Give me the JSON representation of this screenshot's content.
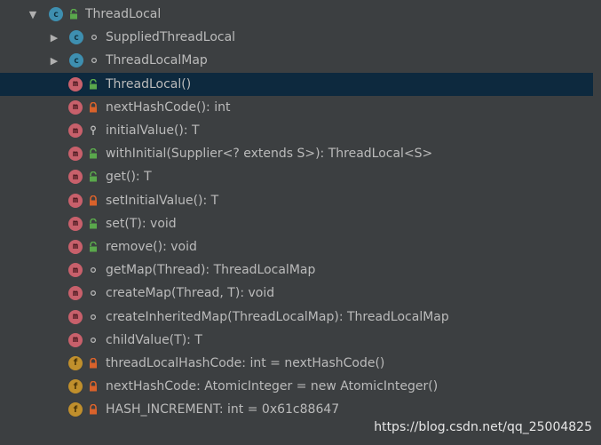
{
  "tree": {
    "root": {
      "label": "ThreadLocal",
      "icon": "class-icon",
      "visibility": "public",
      "expanded": true
    },
    "children": [
      {
        "label": "SuppliedThreadLocal",
        "icon": "class-icon",
        "visibility": "package",
        "collapsed": true
      },
      {
        "label": "ThreadLocalMap",
        "icon": "class-icon",
        "visibility": "package",
        "collapsed": true
      },
      {
        "label": "ThreadLocal()",
        "icon": "method-icon",
        "visibility": "public",
        "selected": true
      },
      {
        "label": "nextHashCode(): int",
        "icon": "method-icon",
        "visibility": "private"
      },
      {
        "label": "initialValue(): T",
        "icon": "method-icon",
        "visibility": "protected"
      },
      {
        "label": "withInitial(Supplier<? extends S>): ThreadLocal<S>",
        "icon": "method-icon",
        "visibility": "public"
      },
      {
        "label": "get(): T",
        "icon": "method-icon",
        "visibility": "public"
      },
      {
        "label": "setInitialValue(): T",
        "icon": "method-icon",
        "visibility": "private"
      },
      {
        "label": "set(T): void",
        "icon": "method-icon",
        "visibility": "public"
      },
      {
        "label": "remove(): void",
        "icon": "method-icon",
        "visibility": "public"
      },
      {
        "label": "getMap(Thread): ThreadLocalMap",
        "icon": "method-icon",
        "visibility": "package"
      },
      {
        "label": "createMap(Thread, T): void",
        "icon": "method-icon",
        "visibility": "package"
      },
      {
        "label": "createInheritedMap(ThreadLocalMap): ThreadLocalMap",
        "icon": "method-icon",
        "visibility": "package"
      },
      {
        "label": "childValue(T): T",
        "icon": "method-icon",
        "visibility": "package"
      },
      {
        "label": "threadLocalHashCode: int = nextHashCode()",
        "icon": "field-icon",
        "visibility": "private"
      },
      {
        "label": "nextHashCode: AtomicInteger = new AtomicInteger()",
        "icon": "field-icon",
        "visibility": "private"
      },
      {
        "label": "HASH_INCREMENT: int = 0x61c88647",
        "icon": "field-icon",
        "visibility": "private"
      }
    ]
  },
  "watermark": "https://blog.csdn.net/qq_25004825",
  "colors": {
    "background": "#3c3f41",
    "selection": "#0d293e",
    "text": "#bbbbbb",
    "class_icon": "#3e8fb0",
    "method_icon": "#c8606b",
    "field_icon": "#c08f2c",
    "public_lock": "#5aa84c",
    "private_lock": "#d9622b"
  }
}
